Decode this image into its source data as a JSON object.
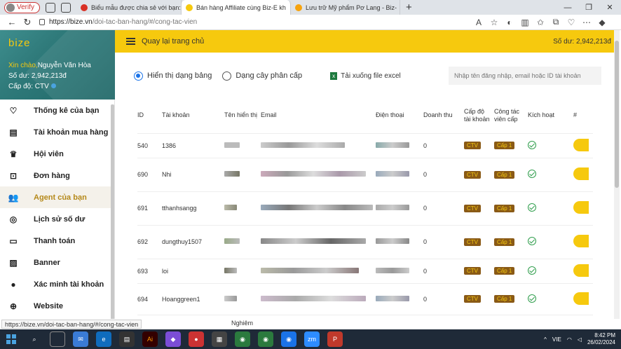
{
  "browser": {
    "profile_label": "Verify",
    "tabs": [
      {
        "title": "Biểu mẫu được chia sẻ với bạn:",
        "color": "#d93025"
      },
      {
        "title": "Bán hàng Affiliate cùng Biz-E kh",
        "color": "#f6c90e"
      },
      {
        "title": "Lưu trữ Mỹ phẩm Pơ Lang - Biz-",
        "color": "#f6a30e"
      }
    ],
    "url_host": "https://bize.vn",
    "url_path": "/doi-tac-ban-hang/#/cong-tac-vien"
  },
  "header": {
    "back_label": "Quay lại trang chủ",
    "balance": "Số dư: 2,942,213đ"
  },
  "profile": {
    "logo": "bize",
    "greeting": "Xin chào,",
    "name": "Nguyễn Văn Hòa",
    "balance": "Số dư: 2,942,213đ",
    "level": "Cấp độ: CTV"
  },
  "sidebar": {
    "items": [
      {
        "label": "Thống kê của bạn",
        "icon": "heart-icon"
      },
      {
        "label": "Tài khoản mua hàng",
        "icon": "receipt-icon"
      },
      {
        "label": "Hội viên",
        "icon": "crown-icon"
      },
      {
        "label": "Đơn hàng",
        "icon": "scan-icon"
      },
      {
        "label": "Agent của bạn",
        "icon": "users-icon"
      },
      {
        "label": "Lịch sử số dư",
        "icon": "fingerprint-icon"
      },
      {
        "label": "Thanh toán",
        "icon": "card-icon"
      },
      {
        "label": "Banner",
        "icon": "image-icon"
      },
      {
        "label": "Xác minh tài khoản",
        "icon": "person-icon"
      },
      {
        "label": "Website",
        "icon": "globe-icon"
      }
    ]
  },
  "controls": {
    "option_table": "Hiển thị dạng bảng",
    "option_tree": "Dạng cây phân cấp",
    "download": "Tải xuống file excel",
    "search_placeholder": "Nhập tên đăng nhập, email hoặc ID tài khoản"
  },
  "table": {
    "headers": [
      "ID",
      "Tài khoản",
      "Tên hiển thị",
      "Email",
      "Điện thoại",
      "Doanh thu",
      "Cấp độ tài khoản",
      "Công tác viên cấp",
      "Kích hoạt",
      "#"
    ],
    "rows": [
      {
        "id": "540",
        "account": "1386",
        "revenue": "0",
        "level": "CTV",
        "tier": "Cấp 1"
      },
      {
        "id": "690",
        "account": "Nhi",
        "revenue": "0",
        "level": "CTV",
        "tier": "Cấp 1"
      },
      {
        "id": "691",
        "account": "tthanhsangg",
        "revenue": "0",
        "level": "CTV",
        "tier": "Cấp 1"
      },
      {
        "id": "692",
        "account": "dungthuy1507",
        "revenue": "0",
        "level": "CTV",
        "tier": "Cấp 1"
      },
      {
        "id": "693",
        "account": "loi",
        "revenue": "0",
        "level": "CTV",
        "tier": "Cấp 1"
      },
      {
        "id": "694",
        "account": "Hoanggreen1",
        "revenue": "0",
        "level": "CTV",
        "tier": "Cấp 1"
      }
    ]
  },
  "status": {
    "url": "https://bize.vn/doi-tac-ban-hang/#/cong-tac-vien",
    "extra": "Nghiêm"
  },
  "taskbar": {
    "lang": "VIE",
    "time": "8:42 PM",
    "date": "26/02/2024"
  }
}
